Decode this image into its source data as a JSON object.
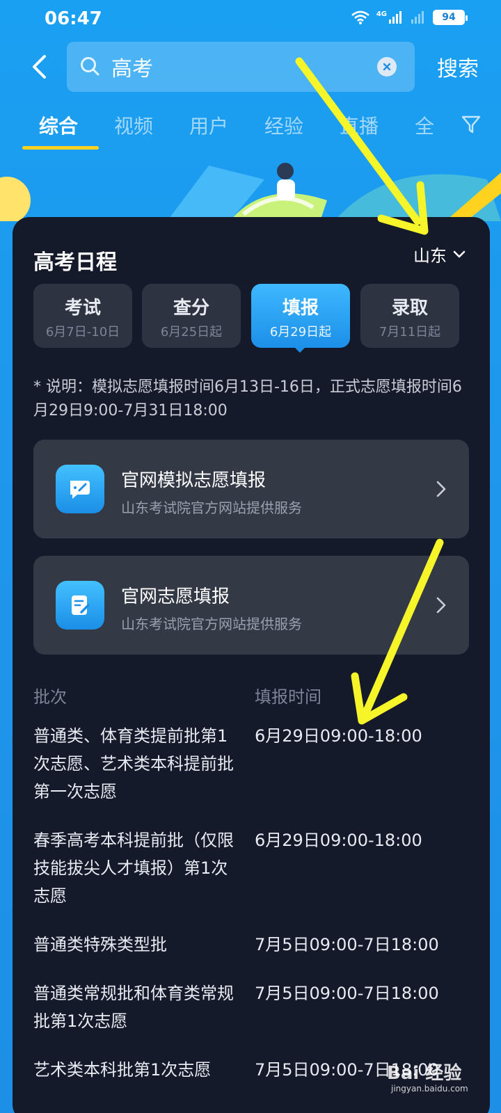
{
  "status_bar": {
    "time": "06:47",
    "network": "4G",
    "battery": "94"
  },
  "search": {
    "query": "高考",
    "button_label": "搜索"
  },
  "tabs": [
    {
      "label": "综合"
    },
    {
      "label": "视频"
    },
    {
      "label": "用户"
    },
    {
      "label": "经验"
    },
    {
      "label": "直播"
    },
    {
      "label": "全"
    }
  ],
  "card": {
    "title": "高考日程",
    "region": "山东",
    "stages": [
      {
        "label": "考试",
        "date": "6月7日-10日"
      },
      {
        "label": "查分",
        "date": "6月25日起"
      },
      {
        "label": "填报",
        "date": "6月29日起"
      },
      {
        "label": "录取",
        "date": "7月11日起"
      }
    ],
    "active_stage": "填报",
    "note": "* 说明：模拟志愿填报时间6月13日-16日，正式志愿填报时间6月29日9:00-7月31日18:00",
    "services": [
      {
        "title": "官网模拟志愿填报",
        "subtitle": "山东考试院官方网站提供服务",
        "icon": "chat-edit-icon"
      },
      {
        "title": "官网志愿填报",
        "subtitle": "山东考试院官方网站提供服务",
        "icon": "document-edit-icon"
      }
    ],
    "table": {
      "headers": [
        "批次",
        "填报时间"
      ],
      "rows": [
        {
          "batch": "普通类、体育类提前批第1次志愿、艺术类本科提前批第一次志愿",
          "time": "6月29日09:00-18:00"
        },
        {
          "batch": "春季高考本科提前批（仅限技能拔尖人才填报）第1次志愿",
          "time": "6月29日09:00-18:00"
        },
        {
          "batch": "普通类特殊类型批",
          "time": "7月5日09:00-7日18:00"
        },
        {
          "batch": "普通类常规批和体育类常规批第1次志愿",
          "time": "7月5日09:00-7日18:00"
        },
        {
          "batch": "艺术类本科批第1次志愿",
          "time": "7月5日09:00-7日18:00"
        }
      ]
    }
  },
  "watermark": {
    "text": "Bai 经验",
    "url": "jingyan.baidu.com"
  },
  "colors": {
    "accent": "#1c8fe8",
    "tab_underline": "#ffd21f",
    "arrow": "#f5f52a",
    "card_bg": "#151a2a"
  }
}
